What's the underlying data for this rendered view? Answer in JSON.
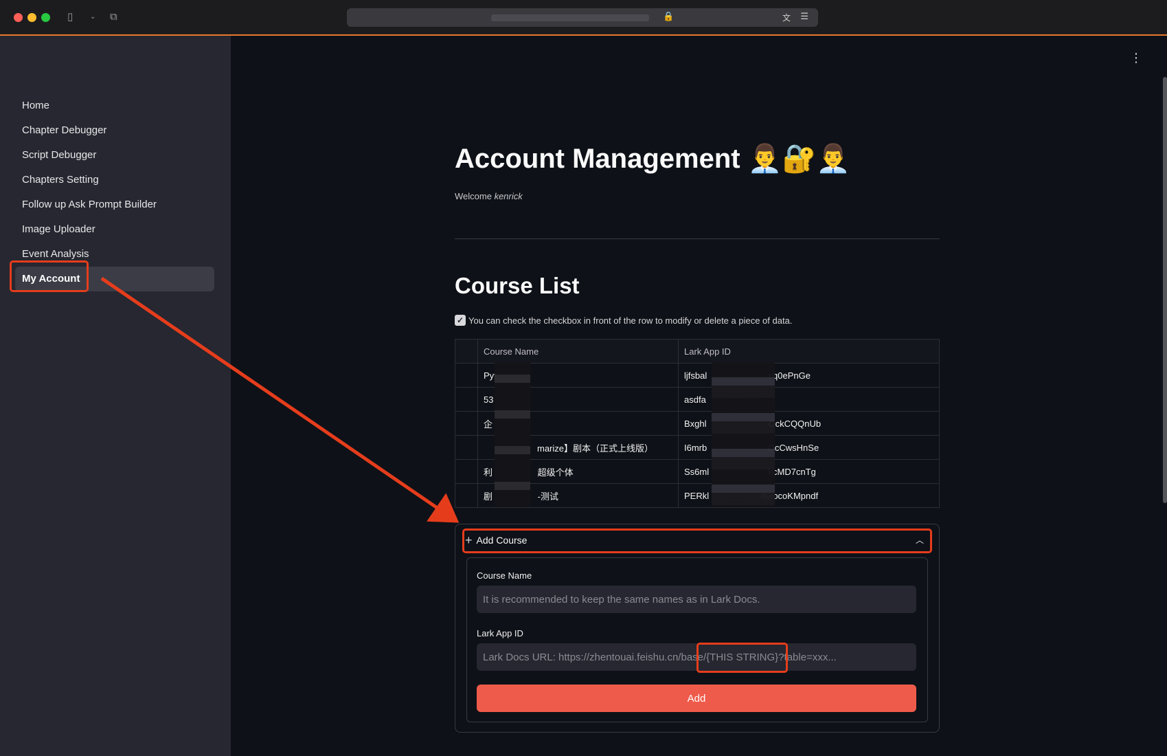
{
  "browser": {
    "url_blurred": "",
    "icons": [
      "sidebar-toggle-icon",
      "chevron-down-icon",
      "tabs-icon",
      "lock-icon",
      "translate-icon",
      "reader-icon"
    ]
  },
  "sidebar": {
    "items": [
      {
        "label": "Home",
        "active": false
      },
      {
        "label": "Chapter Debugger",
        "active": false
      },
      {
        "label": "Script Debugger",
        "active": false
      },
      {
        "label": "Chapters Setting",
        "active": false
      },
      {
        "label": "Follow up Ask Prompt Builder",
        "active": false
      },
      {
        "label": "Image Uploader",
        "active": false
      },
      {
        "label": "Event Analysis",
        "active": false
      },
      {
        "label": "My Account",
        "active": true
      }
    ]
  },
  "page": {
    "title": "Account Management 👨‍💼🔐👨‍💼",
    "welcome_prefix": "Welcome",
    "username": "kenrick",
    "course_list_heading": "Course List",
    "checkbox_caption": "You can check the checkbox in front of the row to modify or delete a piece of data."
  },
  "table": {
    "columns": [
      "Course Name",
      "Lark App ID"
    ],
    "rows": [
      [
        "Pyt",
        "ljfsbal",
        "cq0ePnGe"
      ],
      [
        "53",
        "asdfa",
        ""
      ],
      [
        "企",
        "Bxghl",
        "OckCQQnUb"
      ],
      [
        "marize】剧本（正式上线版）",
        "I6mrb",
        "DcCwsHnSe"
      ],
      [
        "利 超级个体",
        "Ss6ml",
        "kcMD7cnTg"
      ],
      [
        "剧 -测试",
        "PERkl",
        "AwocoKMpndf"
      ]
    ]
  },
  "add_course": {
    "header": "Add Course",
    "course_name_label": "Course Name",
    "course_name_placeholder": "It is recommended to keep the same names as in Lark Docs.",
    "lark_app_id_label": "Lark App ID",
    "lark_app_id_placeholder": "Lark Docs URL: https://zhentouai.feishu.cn/base/{THIS STRING}?table=xxx...",
    "button_label": "Add"
  },
  "colors": {
    "accent": "#ef5b4b",
    "annotation": "#e53d1c",
    "sidebar_bg": "#262730",
    "main_bg": "#0e1117"
  }
}
